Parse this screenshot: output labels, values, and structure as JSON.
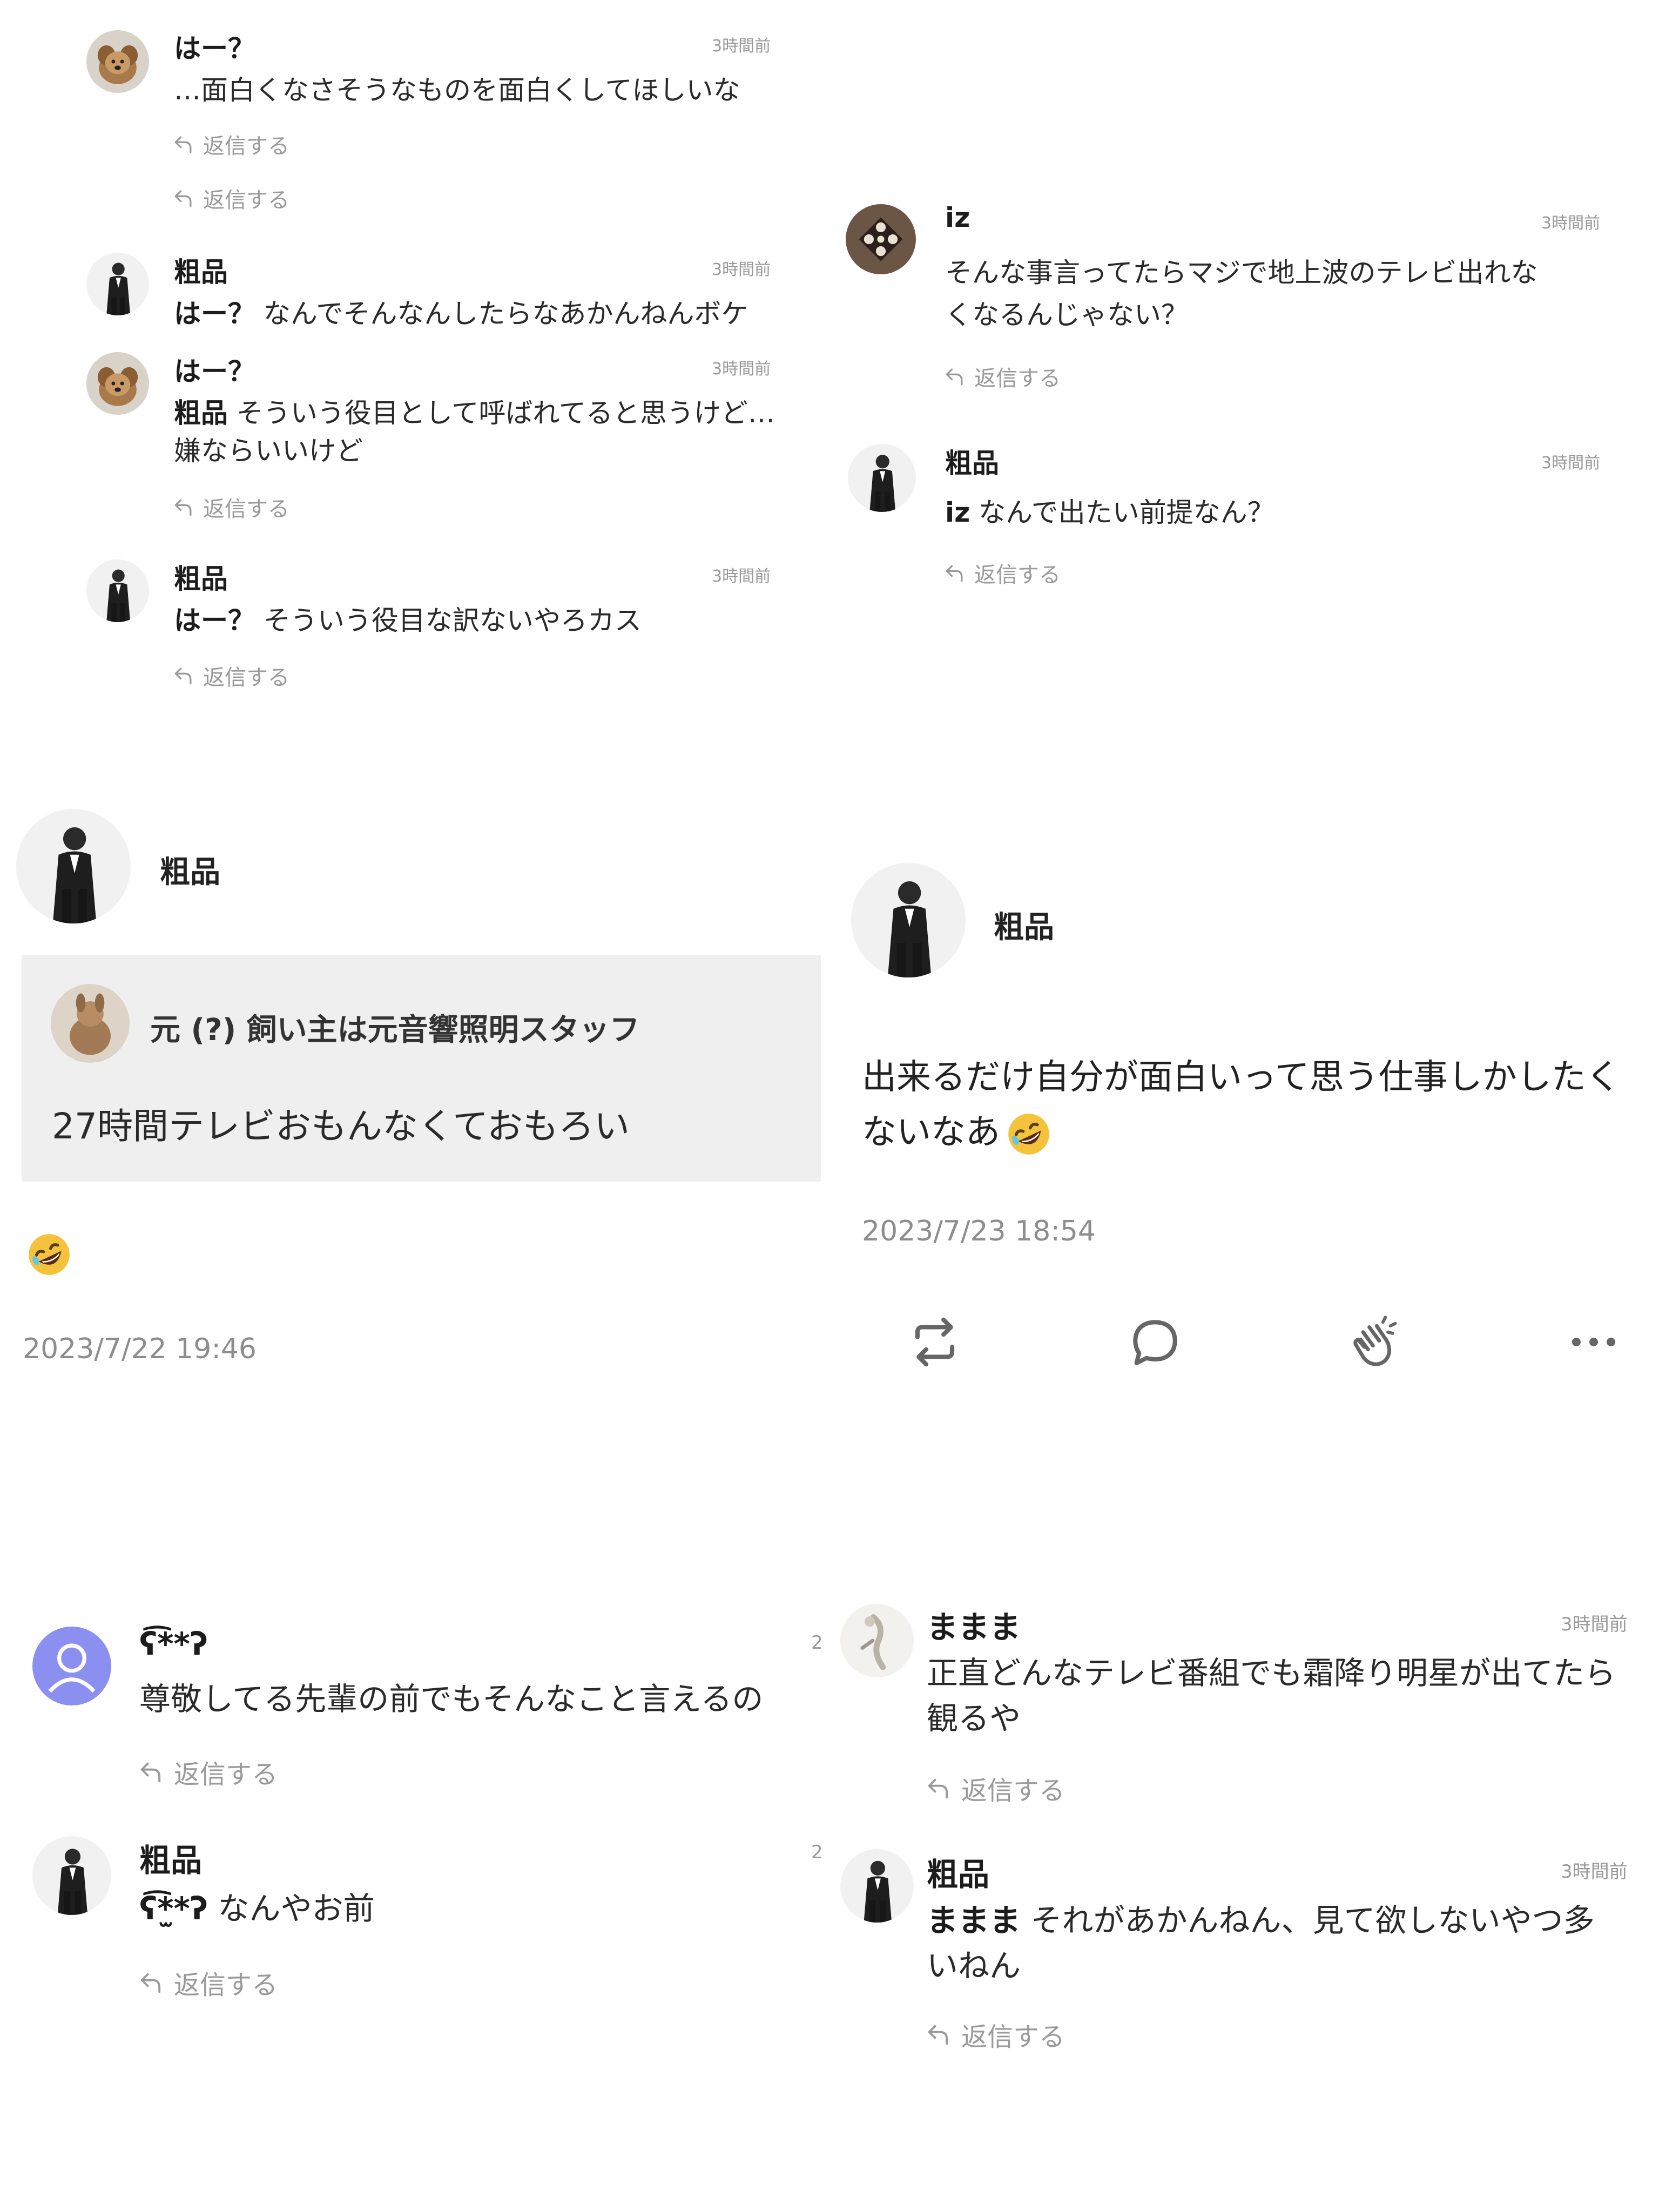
{
  "panel1": {
    "comments": [
      {
        "name": "はー？",
        "time": "3時間前",
        "text": "…面白くなさそうなものを面白くしてほしいな",
        "reply": "返信する",
        "reply2": "返信する"
      },
      {
        "name": "粗品",
        "time": "3時間前",
        "mention": "はー？",
        "text": " なんでそんなんしたらなあかんねんボケ"
      },
      {
        "name": "はー？",
        "time": "3時間前",
        "mention": "粗品",
        "text": " そういう役目として呼ばれてると思うけど…",
        "text2": "嫌ならいいけど",
        "reply": "返信する"
      },
      {
        "name": "粗品",
        "time": "3時間前",
        "mention": "はー？",
        "text": " そういう役目な訳ないやろカス",
        "reply": "返信する"
      }
    ]
  },
  "panel2": {
    "comments": [
      {
        "name": "iz",
        "time": "3時間前",
        "text": "そんな事言ってたらマジで地上波のテレビ出れな",
        "text2": "くなるんじゃない？",
        "reply": "返信する"
      },
      {
        "name": "粗品",
        "time": "3時間前",
        "mention": "iz",
        "text": " なんで出たい前提なん？",
        "reply": "返信する"
      }
    ]
  },
  "panel3": {
    "author": "粗品",
    "quote": {
      "title": "元 (?) 飼い主は元音響照明スタッフ",
      "body": "27時間テレビおもんなくておもろい"
    },
    "emoji": "rolling-on-the-floor-laughing-emoji",
    "timestamp": "2023/7/22 19:46"
  },
  "panel4": {
    "author": "粗品",
    "body_line1": "出来るだけ自分が面白いって思う仕事しかしたく",
    "body_line2": "ないなあ",
    "emoji": "rolling-on-the-floor-laughing-emoji",
    "timestamp": "2023/7/23 18:54",
    "actions": [
      "repost-icon",
      "comment-icon",
      "clap-icon",
      "more-icon"
    ]
  },
  "panel5": {
    "comments": [
      {
        "name": "ʕ͡**ʔ",
        "time": "2",
        "text": "尊敬してる先輩の前でもそんなこと言えるの",
        "reply": "返信する"
      },
      {
        "name": "粗品",
        "time": "2",
        "mention": "ʕ͡*̫*ʔ",
        "text": " なんやお前",
        "reply": "返信する"
      }
    ]
  },
  "panel6": {
    "comments": [
      {
        "name": "ままま",
        "time": "3時間前",
        "text": "正直どんなテレビ番組でも霜降り明星が出てたら",
        "text2": "観るや",
        "reply": "返信する"
      },
      {
        "name": "粗品",
        "time": "3時間前",
        "mention": "ままま",
        "text": " それがあかんねん、見て欲しないやつ多",
        "text2": "いねん",
        "reply": "返信する"
      }
    ]
  },
  "colors": {
    "background": "#ffffff",
    "quote_bg": "#efefef",
    "muted": "#9a9a9a",
    "default_avatar": "#8a8ff0"
  }
}
